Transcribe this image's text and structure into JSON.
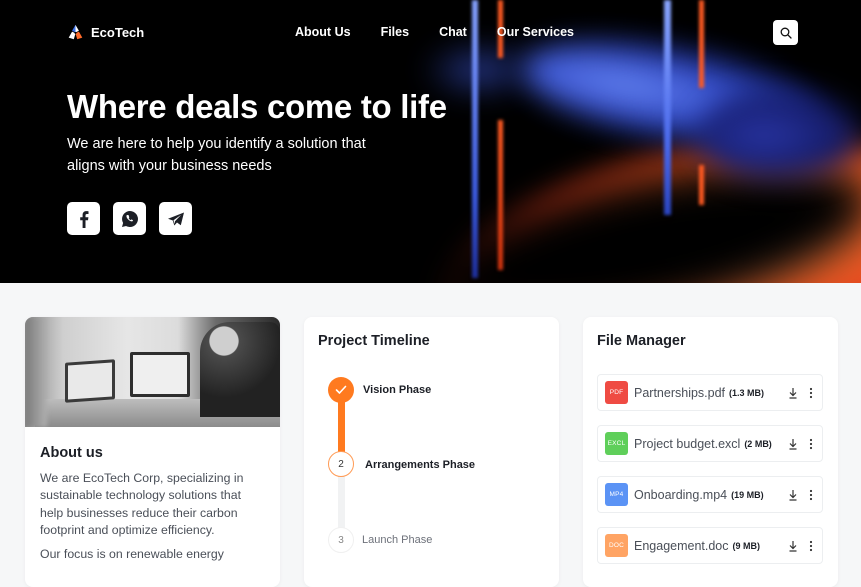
{
  "brand": {
    "name": "EcoTech"
  },
  "nav": {
    "links": [
      "About Us",
      "Files",
      "Chat",
      "Our Services"
    ],
    "search_icon": "search-icon"
  },
  "hero": {
    "title": "Where deals come to life",
    "subtitle": "We are here to help you identify a solution that aligns with your business needs",
    "socials": [
      {
        "name": "Facebook",
        "icon": "facebook-icon"
      },
      {
        "name": "WhatsApp",
        "icon": "whatsapp-icon"
      },
      {
        "name": "Telegram",
        "icon": "telegram-icon"
      }
    ]
  },
  "about": {
    "title": "About us",
    "paragraphs": [
      "We are EcoTech Corp, specializing in sustainable technology solutions that help businesses reduce their carbon footprint and optimize efficiency.",
      "Our focus is on renewable energy"
    ]
  },
  "timeline": {
    "title": "Project Timeline",
    "steps": [
      {
        "number": "1",
        "label": "Vision Phase",
        "status": "done"
      },
      {
        "number": "2",
        "label": "Arrangements Phase",
        "status": "active"
      },
      {
        "number": "3",
        "label": "Launch Phase",
        "status": "pending"
      }
    ]
  },
  "files": {
    "title": "File Manager",
    "items": [
      {
        "type": "PDF",
        "name": "Partnerships.pdf",
        "size": "(1.3 MB)",
        "color": "#ef4b43"
      },
      {
        "type": "EXCL",
        "name": "Project budget.excl",
        "size": "(2 MB)",
        "color": "#5fcf5a"
      },
      {
        "type": "MP4",
        "name": "Onboarding.mp4",
        "size": "(19 MB)",
        "color": "#5b93f5"
      },
      {
        "type": "DOC",
        "name": "Engagement.doc",
        "size": "(9 MB)",
        "color": "#ffa464"
      }
    ]
  },
  "colors": {
    "accent": "#ff7a1f",
    "page_bg": "#f6f7f8",
    "text_dark": "#1c1f26"
  }
}
